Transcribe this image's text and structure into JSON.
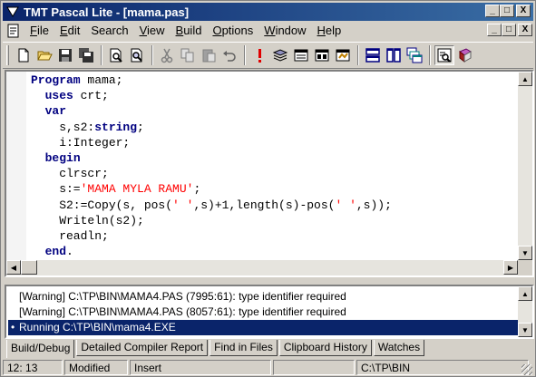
{
  "window": {
    "title": "TMT Pascal Lite - [mama.pas]",
    "title_buttons": [
      "_",
      "□",
      "X"
    ]
  },
  "menu": {
    "items": [
      {
        "label": "File",
        "u": "F",
        "rest": "ile"
      },
      {
        "label": "Edit",
        "u": "E",
        "rest": "dit"
      },
      {
        "label": "Search",
        "u": "",
        "rest": "Search"
      },
      {
        "label": "View",
        "u": "V",
        "rest": "iew"
      },
      {
        "label": "Build",
        "u": "B",
        "rest": "uild"
      },
      {
        "label": "Options",
        "u": "O",
        "rest": "ptions"
      },
      {
        "label": "Window",
        "u": "W",
        "rest": "indow"
      },
      {
        "label": "Help",
        "u": "H",
        "rest": "elp"
      }
    ],
    "mdi_buttons": [
      "_",
      "□",
      "X"
    ]
  },
  "toolbar": {
    "icons": [
      "new-file-icon",
      "open-folder-icon",
      "save-icon",
      "save-all-icon",
      "print-preview-icon",
      "find-icon",
      "cut-icon",
      "copy-icon",
      "paste-icon",
      "undo-icon",
      "compile-icon",
      "build-icon",
      "run-icon",
      "step-icon",
      "debug-icon",
      "tile-horizontal-icon",
      "tile-vertical-icon",
      "cascade-icon",
      "watch-icon",
      "help-book-icon"
    ]
  },
  "editor": {
    "lines": [
      [
        {
          "t": "Program",
          "c": "kw"
        },
        {
          "t": " mama;",
          "c": ""
        }
      ],
      [
        {
          "t": "  ",
          "c": ""
        },
        {
          "t": "uses",
          "c": "kw"
        },
        {
          "t": " crt;",
          "c": ""
        }
      ],
      [
        {
          "t": "  ",
          "c": ""
        },
        {
          "t": "var",
          "c": "kw"
        }
      ],
      [
        {
          "t": "    s,s2:",
          "c": ""
        },
        {
          "t": "string",
          "c": "kw"
        },
        {
          "t": ";",
          "c": ""
        }
      ],
      [
        {
          "t": "    i:Integer;",
          "c": ""
        }
      ],
      [
        {
          "t": "  ",
          "c": ""
        },
        {
          "t": "begin",
          "c": "kw"
        }
      ],
      [
        {
          "t": "    clrscr;",
          "c": ""
        }
      ],
      [
        {
          "t": "    s:=",
          "c": ""
        },
        {
          "t": "'MAMA MYLA RAMU'",
          "c": "str"
        },
        {
          "t": ";",
          "c": ""
        }
      ],
      [
        {
          "t": "    S2:=Copy(s, pos(",
          "c": ""
        },
        {
          "t": "' '",
          "c": "str"
        },
        {
          "t": ",s)+1,length(s)-pos(",
          "c": ""
        },
        {
          "t": "' '",
          "c": "str"
        },
        {
          "t": ",s));",
          "c": ""
        }
      ],
      [
        {
          "t": "    Writeln(s2);",
          "c": ""
        }
      ],
      [
        {
          "t": "    readln;",
          "c": ""
        }
      ],
      [
        {
          "t": "  ",
          "c": ""
        },
        {
          "t": "end",
          "c": "kw"
        },
        {
          "t": ".",
          "c": ""
        }
      ]
    ]
  },
  "messages": {
    "rows": [
      {
        "text": "[Warning] C:\\TP\\BIN\\MAMA4.PAS (7995:61): type identifier required",
        "selected": false
      },
      {
        "text": "[Warning] C:\\TP\\BIN\\MAMA4.PAS (8057:61): type identifier required",
        "selected": false
      },
      {
        "text": "Running C:\\TP\\BIN\\mama4.EXE",
        "selected": true
      }
    ]
  },
  "tabs": [
    {
      "label": "Build/Debug",
      "active": true
    },
    {
      "label": "Detailed Compiler Report",
      "active": false
    },
    {
      "label": "Find in Files",
      "active": false
    },
    {
      "label": "Clipboard History",
      "active": false
    },
    {
      "label": "Watches",
      "active": false
    }
  ],
  "status": {
    "position": "12:  13",
    "modified": "Modified",
    "mode": "Insert",
    "empty": "",
    "path": "C:\\TP\\BIN"
  }
}
